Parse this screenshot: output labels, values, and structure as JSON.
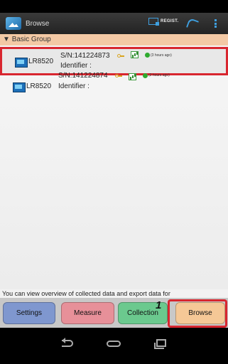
{
  "app": {
    "title": "Browse",
    "regist_label": "REGIST."
  },
  "group": {
    "name": "Basic Group"
  },
  "loggers": [
    {
      "model": "LR8520",
      "serial": "S/N:141224873",
      "identifier": "Identifier :",
      "status": "(3 hours ago)"
    },
    {
      "model": "LR8520",
      "serial": "S/N:141224874",
      "identifier": "Identifier :",
      "status": "(2 hours ago)"
    }
  ],
  "hint": "You can view overview of collected data and export data for",
  "tabs": {
    "settings": "Settings",
    "measure": "Measure",
    "collection": "Collection",
    "browse": "Browse"
  },
  "annotation": {
    "step": "1"
  },
  "colors": {
    "accent": "#3fa0e0",
    "highlight": "#d8262f",
    "group_header": "#f3c9a5"
  }
}
